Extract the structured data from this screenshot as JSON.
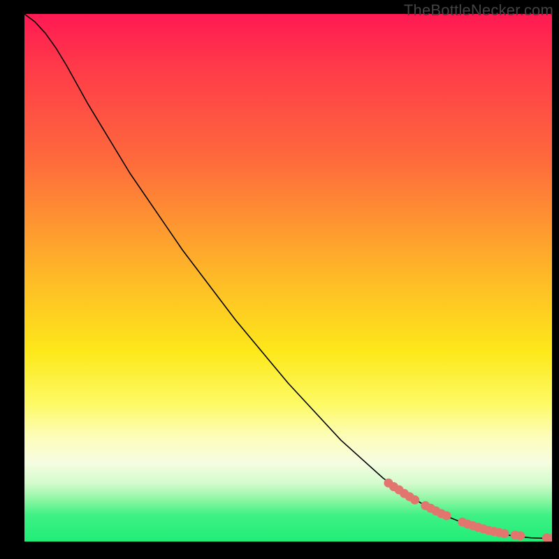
{
  "watermark": "TheBottleNecker.com",
  "chart_data": {
    "type": "line",
    "title": "",
    "xlabel": "",
    "ylabel": "",
    "xlim": [
      0,
      100
    ],
    "ylim": [
      0,
      100
    ],
    "grid": false,
    "background_gradient": {
      "direction": "vertical",
      "stops": [
        {
          "pos": 0,
          "color": "#ff1953"
        },
        {
          "pos": 28,
          "color": "#fe6b3c"
        },
        {
          "pos": 48,
          "color": "#feb329"
        },
        {
          "pos": 64,
          "color": "#fde81a"
        },
        {
          "pos": 80,
          "color": "#fdfdb8"
        },
        {
          "pos": 92,
          "color": "#8ef6a4"
        },
        {
          "pos": 100,
          "color": "#20ed77"
        }
      ]
    },
    "series": [
      {
        "name": "curve",
        "kind": "line",
        "color": "#000000",
        "x": [
          0,
          2,
          4,
          6,
          8,
          12,
          20,
          30,
          40,
          50,
          60,
          68,
          72,
          76,
          80,
          84,
          87,
          90,
          93,
          96,
          99,
          100
        ],
        "y": [
          100,
          98.5,
          96.3,
          93.5,
          90.2,
          83,
          69.8,
          55.2,
          42.0,
          30.0,
          19.2,
          12.0,
          9.2,
          6.8,
          4.8,
          3.2,
          2.2,
          1.5,
          1.0,
          0.7,
          0.6,
          0.6
        ]
      },
      {
        "name": "markers",
        "kind": "scatter",
        "color": "#e2766f",
        "x": [
          69,
          70,
          71,
          72,
          73,
          74,
          76,
          77,
          78,
          79,
          80,
          83,
          84,
          85,
          86,
          87,
          88,
          89,
          90,
          91,
          93,
          94,
          99,
          100
        ],
        "y": [
          11.1,
          10.4,
          9.8,
          9.1,
          8.5,
          7.9,
          6.8,
          6.3,
          5.8,
          5.3,
          4.9,
          3.7,
          3.3,
          3.0,
          2.7,
          2.4,
          2.1,
          1.9,
          1.7,
          1.5,
          1.2,
          1.1,
          0.7,
          0.6
        ]
      }
    ]
  }
}
